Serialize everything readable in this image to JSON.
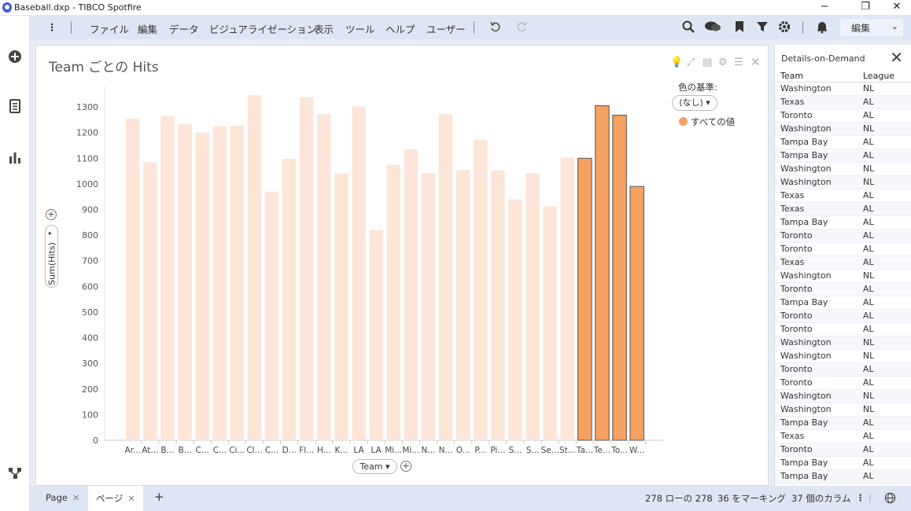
{
  "window": {
    "title": "Baseball.dxp - TIBCO Spotfire",
    "minimize": "−",
    "restore": "❐",
    "close": "✕"
  },
  "menu": {
    "items": [
      "ファイル",
      "編集",
      "データ",
      "ビジュアライゼーション",
      "表示",
      "ツール",
      "ヘルプ",
      "ユーザー"
    ],
    "edit_mode": "編集"
  },
  "viz": {
    "title": "Team ごとの Hits",
    "color_by_label": "色の基準:",
    "color_by_value": "(なし) ▾",
    "legend_label": "すべての値",
    "yaxis_label": "Sum(Hits)",
    "xaxis_label": "Team ▾"
  },
  "chart_data": {
    "type": "bar",
    "categories": [
      "Ar...",
      "At...",
      "B...",
      "B...",
      "C...",
      "C...",
      "Ci...",
      "Cl...",
      "C...",
      "D...",
      "Fl...",
      "H...",
      "K...",
      "LA",
      "LA",
      "Mi...",
      "Mi...",
      "N...",
      "N...",
      "O...",
      "P...",
      "Pi...",
      "S...",
      "S...",
      "Se...",
      "St...",
      "Ta...",
      "Te...",
      "To...",
      "W..."
    ],
    "values": [
      1255,
      1085,
      1265,
      1232,
      1200,
      1225,
      1228,
      1346,
      970,
      1098,
      1338,
      1272,
      1040,
      1302,
      820,
      1075,
      1135,
      1042,
      1272,
      1055,
      1172,
      1052,
      940,
      1042,
      912,
      1102,
      1100,
      1305,
      1268,
      990
    ],
    "marked": [
      false,
      false,
      false,
      false,
      false,
      false,
      false,
      false,
      false,
      false,
      false,
      false,
      false,
      false,
      false,
      false,
      false,
      false,
      false,
      false,
      false,
      false,
      false,
      false,
      false,
      false,
      true,
      true,
      true,
      true
    ],
    "ylim": [
      0,
      1380
    ],
    "yticks": [
      0,
      100,
      200,
      300,
      400,
      500,
      600,
      700,
      800,
      900,
      1000,
      1100,
      1200,
      1300
    ],
    "color_unmarked": "#fde6d8",
    "color_marked": "#f5a161",
    "ylabel": "Sum(Hits)",
    "xlabel": "Team"
  },
  "dod": {
    "title": "Details-on-Demand",
    "columns": [
      "Team",
      "League"
    ],
    "rows": [
      [
        "Washington",
        "NL"
      ],
      [
        "Texas",
        "AL"
      ],
      [
        "Toronto",
        "AL"
      ],
      [
        "Washington",
        "NL"
      ],
      [
        "Tampa Bay",
        "AL"
      ],
      [
        "Tampa Bay",
        "AL"
      ],
      [
        "Washington",
        "NL"
      ],
      [
        "Washington",
        "NL"
      ],
      [
        "Texas",
        "AL"
      ],
      [
        "Texas",
        "AL"
      ],
      [
        "Tampa Bay",
        "AL"
      ],
      [
        "Toronto",
        "AL"
      ],
      [
        "Toronto",
        "AL"
      ],
      [
        "Texas",
        "AL"
      ],
      [
        "Washington",
        "NL"
      ],
      [
        "Toronto",
        "AL"
      ],
      [
        "Tampa Bay",
        "AL"
      ],
      [
        "Toronto",
        "AL"
      ],
      [
        "Toronto",
        "AL"
      ],
      [
        "Washington",
        "NL"
      ],
      [
        "Washington",
        "NL"
      ],
      [
        "Toronto",
        "AL"
      ],
      [
        "Toronto",
        "AL"
      ],
      [
        "Washington",
        "NL"
      ],
      [
        "Washington",
        "NL"
      ],
      [
        "Tampa Bay",
        "AL"
      ],
      [
        "Texas",
        "AL"
      ],
      [
        "Toronto",
        "AL"
      ],
      [
        "Tampa Bay",
        "AL"
      ],
      [
        "Tampa Bay",
        "AL"
      ]
    ]
  },
  "status": {
    "tab1": "Page",
    "tab2": "ページ",
    "rows": "278 ローの 278",
    "marked": "36 をマーキング",
    "columns": "37 個のカラム"
  }
}
